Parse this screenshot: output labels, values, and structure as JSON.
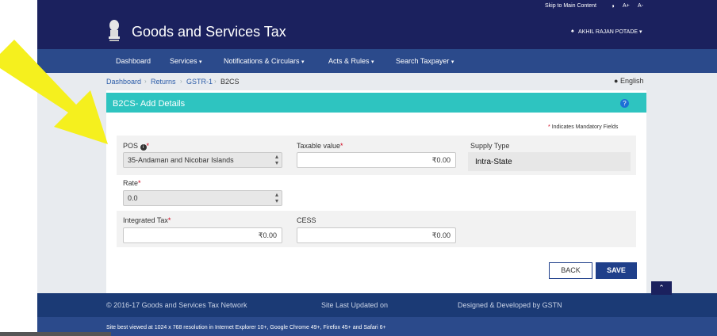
{
  "topbar": {
    "skip_link": "Skip to Main Content",
    "contrast_icon": "contrast-icon",
    "font_increase": "A+",
    "font_decrease": "A-"
  },
  "header": {
    "title": "Goods and Services Tax",
    "emblem_icon": "national-emblem-icon",
    "user_name": "AKHIL RAJAN POTADE",
    "user_icon": "user-icon"
  },
  "nav": {
    "items": [
      {
        "label": "Dashboard",
        "has_dropdown": false
      },
      {
        "label": "Services",
        "has_dropdown": true
      },
      {
        "label": "Notifications & Circulars",
        "has_dropdown": true
      },
      {
        "label": "Acts & Rules",
        "has_dropdown": true
      },
      {
        "label": "Search Taxpayer",
        "has_dropdown": true
      }
    ]
  },
  "breadcrumb": {
    "items": [
      "Dashboard",
      "Returns",
      "GSTR-1",
      "B2CS"
    ],
    "language": "English",
    "language_icon": "globe-icon"
  },
  "form": {
    "title": "B2CS- Add Details",
    "help_icon": "help-icon",
    "mandatory_note": "Indicates Mandatory Fields",
    "pos": {
      "label": "POS",
      "info_icon": "info-icon",
      "value": "35-Andaman and Nicobar Islands"
    },
    "taxable_value": {
      "label": "Taxable value",
      "value": "₹0.00"
    },
    "supply_type": {
      "label": "Supply Type",
      "value": "Intra-State"
    },
    "rate": {
      "label": "Rate",
      "value": "0.0"
    },
    "integrated_tax": {
      "label": "Integrated Tax",
      "value": "₹0.00"
    },
    "cess": {
      "label": "CESS",
      "value": "₹0.00"
    },
    "back_button": "BACK",
    "save_button": "SAVE"
  },
  "footer": {
    "copyright": "© 2016-17 Goods and Services Tax Network",
    "last_updated": "Site Last Updated on",
    "designed_by": "Designed & Developed by GSTN",
    "best_viewed": "Site best viewed at 1024 x 768 resolution in Internet Explorer 10+, Google Chrome 49+, Firefox 45+ and Safari 6+"
  },
  "scroll_top_icon": "chevron-up-icon",
  "colors": {
    "header": "#1b215e",
    "nav": "#2b4a8b",
    "card_header": "#2ec4c0",
    "arrow": "#f5f01e",
    "save_button": "#1f3f8a"
  }
}
